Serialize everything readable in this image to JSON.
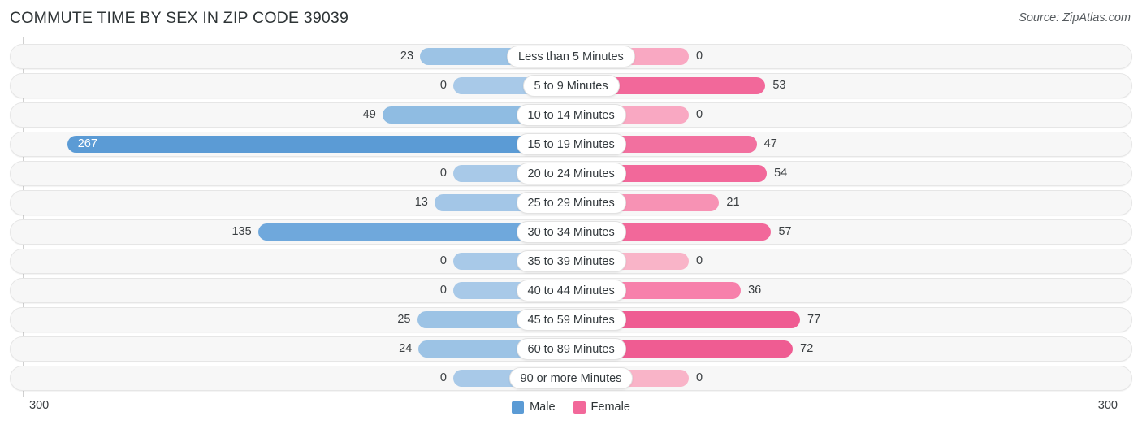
{
  "header": {
    "title": "COMMUTE TIME BY SEX IN ZIP CODE 39039",
    "source": "Source: ZipAtlas.com"
  },
  "legend": {
    "male_label": "Male",
    "female_label": "Female",
    "male_color": "#5b9bd5",
    "female_color": "#f2689a"
  },
  "axis": {
    "left_tick": "300",
    "right_tick": "300",
    "max": 300
  },
  "chart_data": {
    "type": "bar",
    "orientation": "horizontal-diverging",
    "title": "COMMUTE TIME BY SEX IN ZIP CODE 39039",
    "xlabel": "",
    "ylabel": "",
    "xlim": [
      300,
      300
    ],
    "grid": false,
    "legend_position": "bottom-center",
    "categories": [
      "Less than 5 Minutes",
      "5 to 9 Minutes",
      "10 to 14 Minutes",
      "15 to 19 Minutes",
      "20 to 24 Minutes",
      "25 to 29 Minutes",
      "30 to 34 Minutes",
      "35 to 39 Minutes",
      "40 to 44 Minutes",
      "45 to 59 Minutes",
      "60 to 89 Minutes",
      "90 or more Minutes"
    ],
    "series": [
      {
        "name": "Male",
        "color": "#5b9bd5",
        "values": [
          23,
          0,
          49,
          267,
          0,
          13,
          135,
          0,
          0,
          25,
          24,
          0
        ]
      },
      {
        "name": "Female",
        "color": "#f2689a",
        "values": [
          0,
          53,
          0,
          47,
          54,
          21,
          57,
          0,
          36,
          77,
          72,
          0
        ]
      }
    ]
  },
  "rows": [
    {
      "category": "Less than 5 Minutes",
      "male": "23",
      "female": "0",
      "male_color": "#9cc3e5",
      "female_color": "#f9a8c2"
    },
    {
      "category": "5 to 9 Minutes",
      "male": "0",
      "female": "53",
      "male_color": "#a8c9e8",
      "female_color": "#f2689a"
    },
    {
      "category": "10 to 14 Minutes",
      "male": "49",
      "female": "0",
      "male_color": "#8fbce2",
      "female_color": "#f9a8c2"
    },
    {
      "category": "15 to 19 Minutes",
      "male": "267",
      "female": "47",
      "male_color": "#5b9bd5",
      "female_color": "#f2709f"
    },
    {
      "category": "20 to 24 Minutes",
      "male": "0",
      "female": "54",
      "male_color": "#a8c9e8",
      "female_color": "#f2689a"
    },
    {
      "category": "25 to 29 Minutes",
      "male": "13",
      "female": "21",
      "male_color": "#a3c6e7",
      "female_color": "#f792b4"
    },
    {
      "category": "30 to 34 Minutes",
      "male": "135",
      "female": "57",
      "male_color": "#6fa8dc",
      "female_color": "#f2689a"
    },
    {
      "category": "35 to 39 Minutes",
      "male": "0",
      "female": "0",
      "male_color": "#a8c9e8",
      "female_color": "#f9b4c8"
    },
    {
      "category": "40 to 44 Minutes",
      "male": "0",
      "female": "36",
      "male_color": "#a8c9e8",
      "female_color": "#f780ab"
    },
    {
      "category": "45 to 59 Minutes",
      "male": "25",
      "female": "77",
      "male_color": "#9cc3e5",
      "female_color": "#ef5c92"
    },
    {
      "category": "60 to 89 Minutes",
      "male": "24",
      "female": "72",
      "male_color": "#9cc3e5",
      "female_color": "#ef5c92"
    },
    {
      "category": "90 or more Minutes",
      "male": "0",
      "female": "0",
      "male_color": "#a8c9e8",
      "female_color": "#f9b4c8"
    }
  ]
}
